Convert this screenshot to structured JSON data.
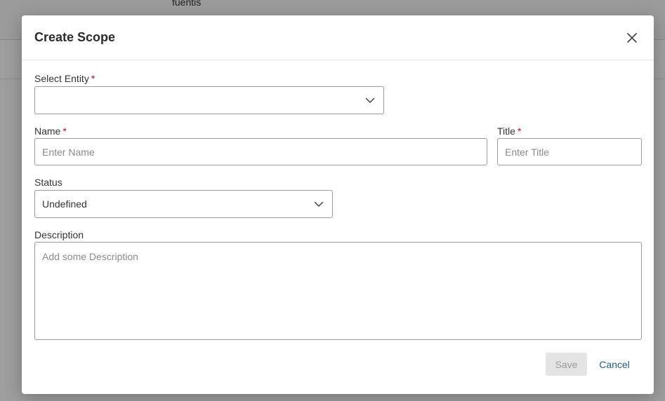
{
  "background": {
    "visible_text": "fuentis"
  },
  "dialog": {
    "title": "Create Scope",
    "close_icon": "close-icon"
  },
  "form": {
    "entity": {
      "label": "Select Entity",
      "required_mark": "*",
      "value": ""
    },
    "name": {
      "label": "Name",
      "required_mark": "*",
      "value": "",
      "placeholder": "Enter Name"
    },
    "title": {
      "label": "Title",
      "required_mark": "*",
      "value": "",
      "placeholder": "Enter Title"
    },
    "status": {
      "label": "Status",
      "value": "Undefined"
    },
    "description": {
      "label": "Description",
      "value": "",
      "placeholder": "Add some Description"
    }
  },
  "actions": {
    "save_label": "Save",
    "cancel_label": "Cancel"
  },
  "colors": {
    "required": "#d0021b",
    "link": "#1f5e8c",
    "disabled_bg": "#e4e4e4"
  }
}
